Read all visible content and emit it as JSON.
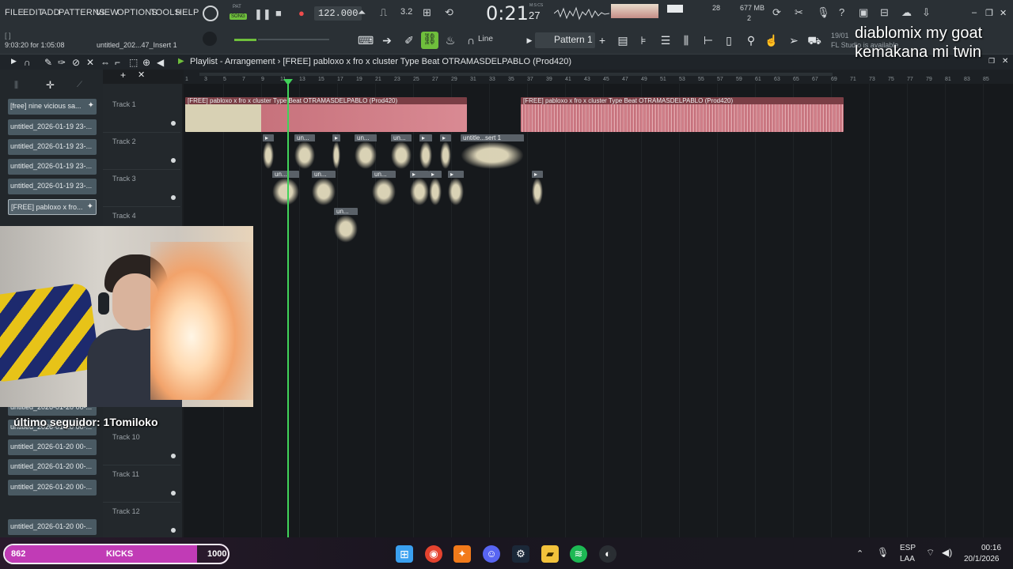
{
  "menu": [
    "FILE",
    "EDIT",
    "ADD",
    "PATTERNS",
    "VIEW",
    "OPTIONS",
    "TOOLS",
    "HELP"
  ],
  "transport": {
    "pat_label": "PAT",
    "song_label": "SONG",
    "tempo": "122.000",
    "time": "0:21",
    "time_sub": "27",
    "time_unit": "M:S:CS",
    "cpu": "28",
    "memory": "677 MB",
    "polyphony": "2",
    "snap": "Line",
    "pattern": "Pattern 1",
    "hint_time": "9:03:20 for 1:05:08",
    "hint_file": "untitled_202...47_Insert 1",
    "news_date": "19/01",
    "news_text": "FL Studio is available"
  },
  "playlist": {
    "title": "Playlist - Arrangement",
    "separator": "›",
    "song": "[FREE] pabloxo x fro x cluster Type Beat OTRAMASDELPABLO (Prod420)"
  },
  "ruler": [
    "1",
    "3",
    "5",
    "7",
    "9",
    "11",
    "13",
    "15",
    "17",
    "19",
    "21",
    "23",
    "25",
    "27",
    "29",
    "31",
    "33",
    "35",
    "37",
    "39",
    "41",
    "43",
    "45",
    "47",
    "49",
    "51",
    "53",
    "55",
    "57",
    "59",
    "61",
    "63",
    "65",
    "67",
    "69",
    "71",
    "73",
    "75",
    "77",
    "79",
    "81",
    "83",
    "85"
  ],
  "picker": [
    "[free] nine vicious sa...",
    "untitled_2026-01-19 23-...",
    "untitled_2026-01-19 23-...",
    "untitled_2026-01-19 23-...",
    "untitled_2026-01-19 23-...",
    "[FREE] pabloxo x fro...",
    "untitled_2026-01-20 00-...",
    "untitled_2026-01-20 00-...",
    "untitled_2026-01-20 00-...",
    "untitled_2026-01-20 00-...",
    "untitled_2026-01-20 00-...",
    "untitled_2026-01-20 00-..."
  ],
  "tracks": [
    "Track 1",
    "Track 2",
    "Track 3",
    "Track 4",
    "Track 10",
    "Track 11",
    "Track 12"
  ],
  "clips": {
    "song": "[FREE] pabloxo x fro x cluster Type Beat OTRAMASDELPABLO (Prod420)",
    "short": "un...",
    "insert": "untitle...sert 1"
  },
  "overlay": {
    "follower": "último seguidor: 1Tomiloko",
    "goat_line1": "diablomix my goat",
    "goat_line2": "kemakana mi twin"
  },
  "goal": {
    "current": "862",
    "label": "KICKS",
    "target": "1000",
    "progress": 0.862
  },
  "tray": {
    "lang1": "ESP",
    "lang2": "LAA",
    "time": "00:16",
    "date": "20/1/2026"
  },
  "colors": {
    "accent_green": "#41d35a",
    "clip_pink": "#d98a93",
    "kicks_pink": "#c13bb6"
  }
}
